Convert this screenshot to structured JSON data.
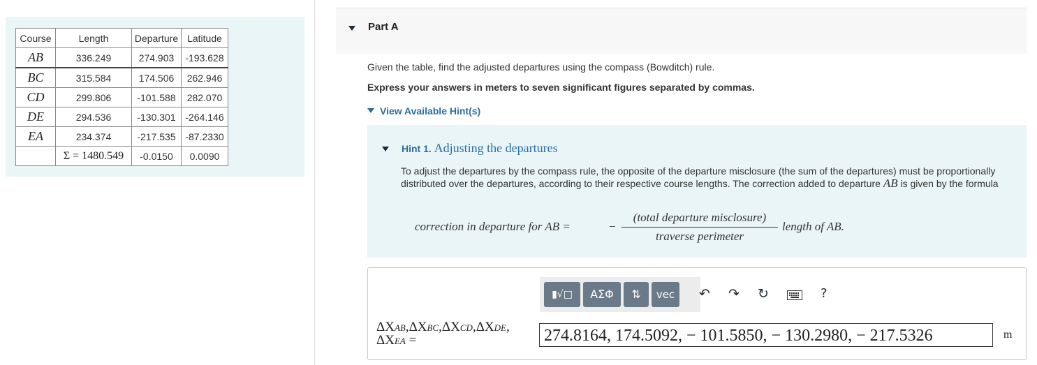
{
  "table": {
    "headers": [
      "Course",
      "Length",
      "Departure",
      "Latitude"
    ],
    "rows": [
      {
        "course": "AB",
        "length": "336.249",
        "departure": "274.903",
        "latitude": "-193.628"
      },
      {
        "course": "BC",
        "length": "315.584",
        "departure": "174.506",
        "latitude": "262.946"
      },
      {
        "course": "CD",
        "length": "299.806",
        "departure": "-101.588",
        "latitude": "282.070"
      },
      {
        "course": "DE",
        "length": "294.536",
        "departure": "-130.301",
        "latitude": "-264.146"
      },
      {
        "course": "EA",
        "length": "234.374",
        "departure": "-217.535",
        "latitude": "-87.2330"
      }
    ],
    "totals": {
      "length": "Σ = 1480.549",
      "departure": "-0.0150",
      "latitude": "0.0090"
    }
  },
  "part": {
    "title": "Part A"
  },
  "question": {
    "text": "Given the table, find the adjusted departures using the compass (Bowditch) rule.",
    "instruction": "Express your answers in meters to seven significant figures separated by commas."
  },
  "hints": {
    "toggle_label": "View Available Hint(s)",
    "hint1": {
      "number": "Hint 1.",
      "title": "Adjusting the departures",
      "text_before": "To adjust the departures by the compass rule, the opposite of the departure misclosure (the sum of the departures) must be proportionally distributed over the departures, according to their respective course lengths. The correction added to departure ",
      "text_var": "AB",
      "text_after": " is given by the formula",
      "formula": {
        "lhs": "correction in departure for AB =",
        "sign": "−",
        "numerator": "(total departure misclosure)",
        "denominator": "traverse perimeter",
        "rhs": "length of AB."
      }
    }
  },
  "toolbar": {
    "templates_label": "▮√□",
    "symbols_label": "ΑΣΦ",
    "arrows_label": "⇅",
    "vec_label": "vec",
    "icons": [
      "undo-icon",
      "redo-icon",
      "reset-icon",
      "keyboard-icon",
      "help-icon"
    ],
    "help_label": "?"
  },
  "answer": {
    "label_line1": "ΔX",
    "subs": [
      "AB",
      "BC",
      "CD",
      "DE",
      "EA"
    ],
    "value": "274.8164, 174.5092, − 101.5850, − 130.2980, − 217.5326",
    "unit": "m"
  }
}
